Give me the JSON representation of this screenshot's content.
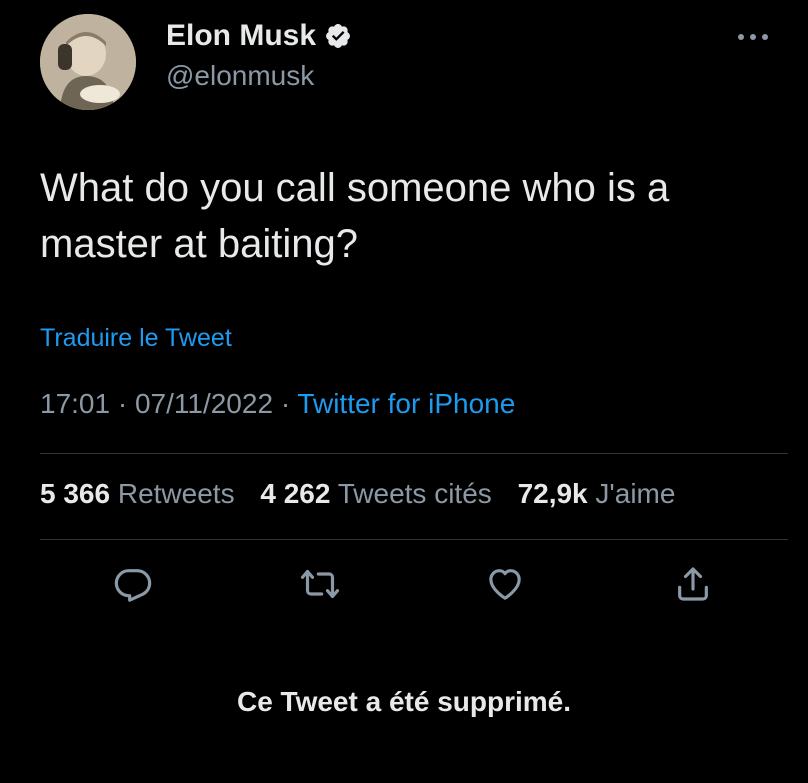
{
  "author": {
    "name": "Elon Musk",
    "handle": "@elonmusk"
  },
  "tweet": {
    "text": "What do you call someone who is a master at baiting?",
    "translate_label": "Traduire le Tweet",
    "time": "17:01",
    "separator": "·",
    "date": "07/11/2022",
    "source": "Twitter for iPhone"
  },
  "stats": {
    "retweets_count": "5 366",
    "retweets_label": "Retweets",
    "quotes_count": "4 262",
    "quotes_label": "Tweets cités",
    "likes_count": "72,9k",
    "likes_label": "J'aime"
  },
  "icons": {
    "verified": "verified-badge-icon",
    "more": "more-horizontal-icon",
    "reply": "reply-icon",
    "retweet": "retweet-icon",
    "like": "heart-icon",
    "share": "share-icon"
  },
  "notice": "Ce Tweet a été supprimé.",
  "colors": {
    "background": "#000000",
    "text": "#e7e9ea",
    "secondary": "#8b98a5",
    "link": "#1d9bf0",
    "divider": "#2f3336"
  }
}
